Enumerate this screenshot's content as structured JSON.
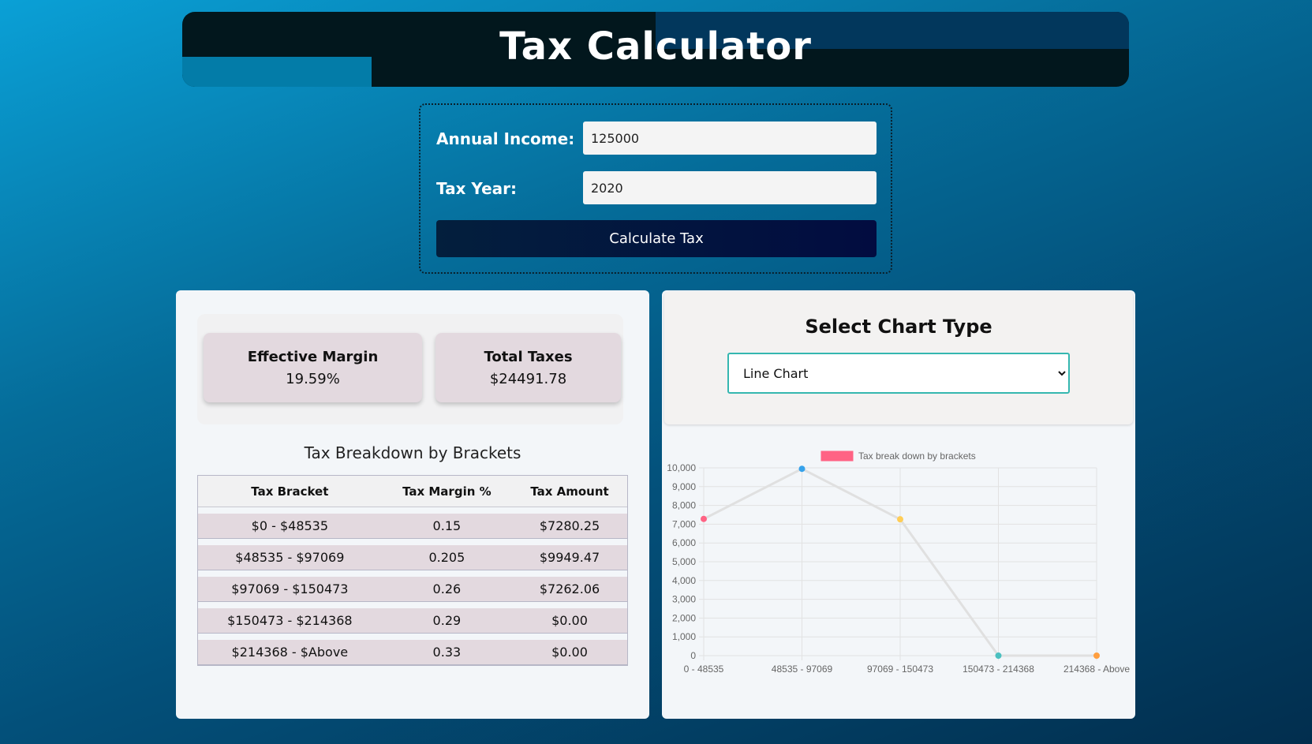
{
  "header": {
    "title": "Tax Calculator"
  },
  "form": {
    "income_label": "Annual Income:",
    "income_value": "125000",
    "year_label": "Tax Year:",
    "year_value": "2020",
    "calculate_label": "Calculate Tax"
  },
  "summary": {
    "effective_margin_label": "Effective Margin",
    "effective_margin_value": "19.59%",
    "total_taxes_label": "Total Taxes",
    "total_taxes_value": "$24491.78"
  },
  "breakdown": {
    "title": "Tax Breakdown by Brackets",
    "columns": [
      "Tax Bracket",
      "Tax Margin %",
      "Tax Amount"
    ],
    "rows": [
      [
        "$0 - $48535",
        "0.15",
        "$7280.25"
      ],
      [
        "$48535 - $97069",
        "0.205",
        "$9949.47"
      ],
      [
        "$97069 - $150473",
        "0.26",
        "$7262.06"
      ],
      [
        "$150473 - $214368",
        "0.29",
        "$0.00"
      ],
      [
        "$214368 - $Above",
        "0.33",
        "$0.00"
      ]
    ]
  },
  "chart_selector": {
    "title": "Select Chart Type",
    "selected": "Line Chart"
  },
  "chart_data": {
    "type": "line",
    "categories": [
      "0 - 48535",
      "48535 - 97069",
      "97069 - 150473",
      "150473 - 214368",
      "214368 - Above"
    ],
    "series": [
      {
        "name": "Tax break down by brackets",
        "values": [
          7280.25,
          9949.47,
          7262.06,
          0,
          0
        ]
      }
    ],
    "point_colors": [
      "#ff6384",
      "#36a2eb",
      "#ffcd56",
      "#4bc0c0",
      "#ff9f40"
    ],
    "legend_color": "#ff6384",
    "line_color": "#e0e0e0",
    "ylim": [
      0,
      10000
    ],
    "yticks": [
      "10,000",
      "9,000",
      "8,000",
      "7,000",
      "6,000",
      "5,000",
      "4,000",
      "3,000",
      "2,000",
      "1,000",
      "0"
    ],
    "grid": true,
    "legend": "top"
  }
}
